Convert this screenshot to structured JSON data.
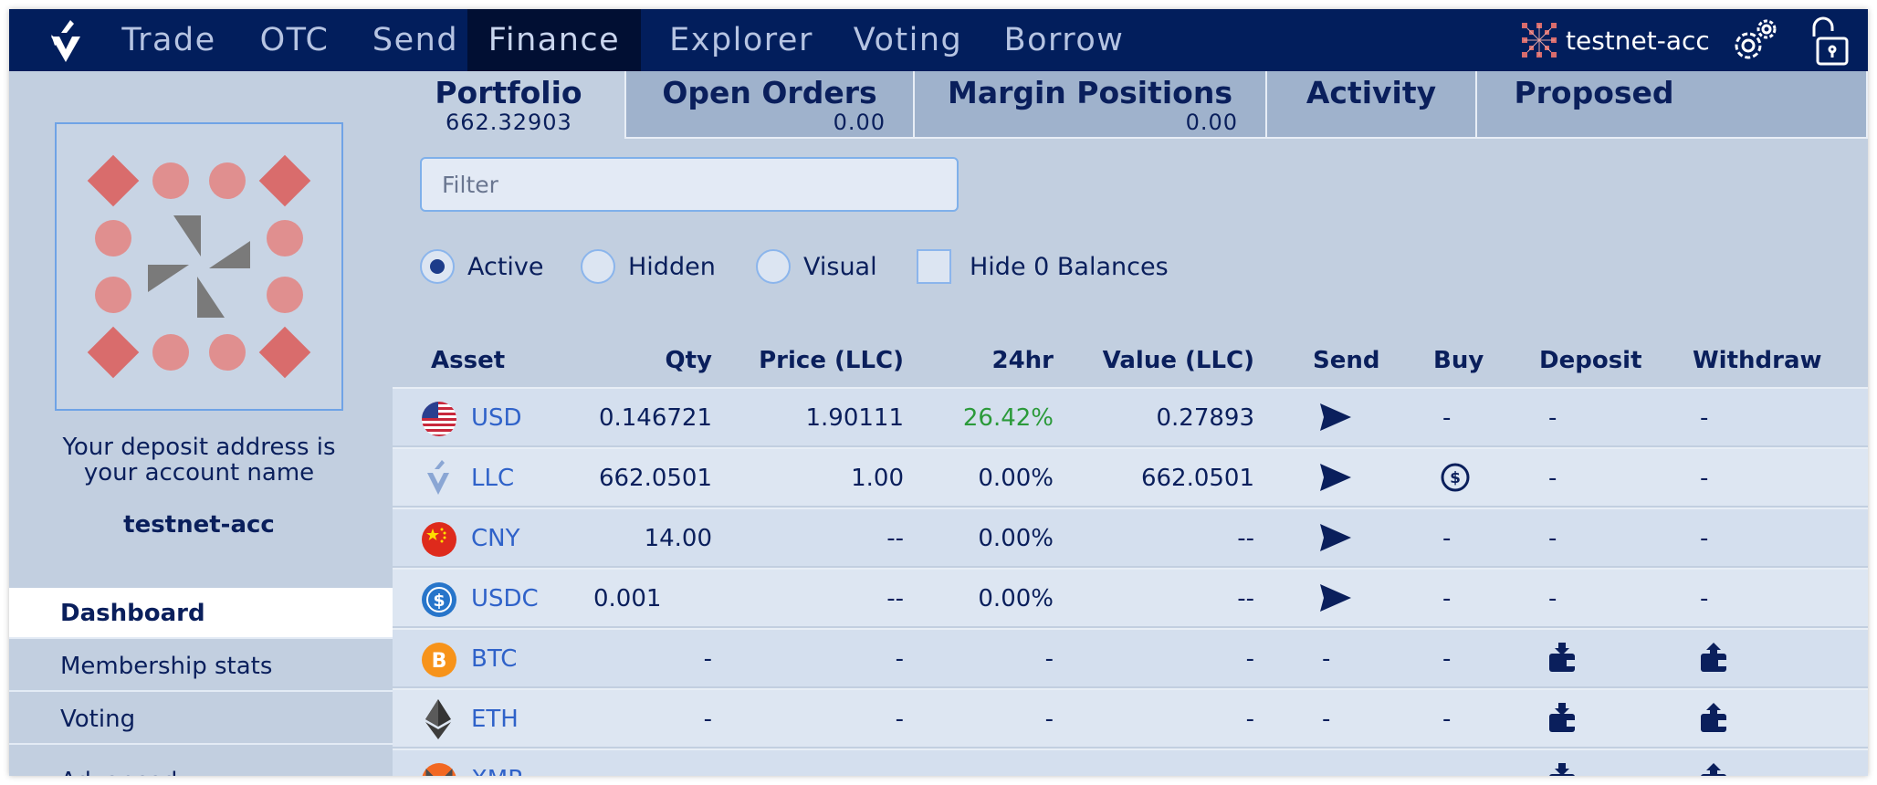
{
  "nav": {
    "items": [
      "Trade",
      "OTC",
      "Send",
      "Finance",
      "Explorer",
      "Voting",
      "Borrow"
    ],
    "active": "Finance",
    "account": "testnet-acc"
  },
  "sidebar": {
    "deposit_line1": "Your deposit address is",
    "deposit_line2": "your account name",
    "account_name": "testnet-acc",
    "items": [
      "Dashboard",
      "Membership stats",
      "Voting",
      "Advanced"
    ],
    "active": "Dashboard"
  },
  "tabs": [
    {
      "label": "Portfolio",
      "value": "662.32903"
    },
    {
      "label": "Open Orders",
      "value": "0.00"
    },
    {
      "label": "Margin Positions",
      "value": "0.00"
    },
    {
      "label": "Activity",
      "value": ""
    },
    {
      "label": "Proposed",
      "value": ""
    }
  ],
  "filter": {
    "placeholder": "Filter",
    "value": ""
  },
  "view_options": {
    "radios": [
      "Active",
      "Hidden",
      "Visual"
    ],
    "selected": "Active",
    "checkbox_label": "Hide 0 Balances",
    "checkbox_checked": false
  },
  "table": {
    "headers": {
      "asset": "Asset",
      "qty": "Qty",
      "price": "Price (LLC)",
      "change": "24hr",
      "value": "Value (LLC)",
      "send": "Send",
      "buy": "Buy",
      "deposit": "Deposit",
      "withdraw": "Withdraw"
    },
    "rows": [
      {
        "asset": "USD",
        "icon": "us-flag-icon",
        "qty": "0.146721",
        "price": "1.90111",
        "change": "26.42%",
        "change_positive": true,
        "value": "0.27893",
        "send": "send-icon",
        "buy": "-",
        "deposit": "-",
        "withdraw": "-"
      },
      {
        "asset": "LLC",
        "icon": "llc-logo-icon",
        "qty": "662.0501",
        "price": "1.00",
        "change": "0.00%",
        "change_positive": false,
        "value": "662.0501",
        "send": "send-icon",
        "buy": "buy-icon",
        "deposit": "-",
        "withdraw": "-"
      },
      {
        "asset": "CNY",
        "icon": "china-flag-icon",
        "qty": "14.00",
        "price": "--",
        "change": "0.00%",
        "change_positive": false,
        "value": "--",
        "send": "send-icon",
        "buy": "-",
        "deposit": "-",
        "withdraw": "-"
      },
      {
        "asset": "USDC",
        "icon": "usdc-coin-icon",
        "qty": "0.001",
        "price": "--",
        "change": "0.00%",
        "change_positive": false,
        "value": "--",
        "send": "send-icon",
        "buy": "-",
        "deposit": "-",
        "withdraw": "-"
      },
      {
        "asset": "BTC",
        "icon": "bitcoin-icon",
        "qty": "-",
        "price": "-",
        "change": "-",
        "change_positive": false,
        "value": "-",
        "send": "-",
        "buy": "-",
        "deposit": "deposit-icon",
        "withdraw": "withdraw-icon"
      },
      {
        "asset": "ETH",
        "icon": "ethereum-icon",
        "qty": "-",
        "price": "-",
        "change": "-",
        "change_positive": false,
        "value": "-",
        "send": "-",
        "buy": "-",
        "deposit": "deposit-icon",
        "withdraw": "withdraw-icon"
      },
      {
        "asset": "XMR",
        "icon": "monero-icon",
        "qty": "-",
        "price": "-",
        "change": "-",
        "change_positive": false,
        "value": "-",
        "send": "-",
        "buy": "-",
        "deposit": "deposit-icon",
        "withdraw": "withdraw-icon"
      }
    ]
  },
  "colors": {
    "nav_bg": "#021e5c",
    "nav_active_bg": "#010f33",
    "page_bg": "#c2cfe0",
    "link": "#2f62c9",
    "positive": "#2b9a3a",
    "avatar_diamond": "#d96c6c",
    "avatar_circle": "#e08f8f"
  }
}
